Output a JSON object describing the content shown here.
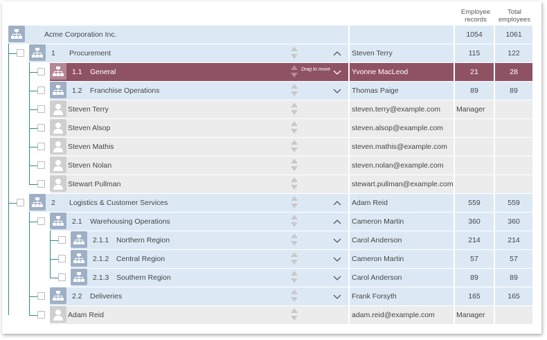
{
  "columns": {
    "records": "Employee records",
    "total": "Total employees"
  },
  "drag_hint": "Drag to move",
  "rows": [
    {
      "kind": "root",
      "num": "",
      "title": "Acme Corporation Inc.",
      "manager": "",
      "records": "1054",
      "total": "1061",
      "chevron": ""
    },
    {
      "kind": "unit",
      "num": "1",
      "title": "Procurement",
      "manager": "Steven Terry",
      "records": "115",
      "total": "122",
      "chevron": "up"
    },
    {
      "kind": "unit",
      "num": "1.1",
      "title": "General",
      "manager": "Yvonne MacLeod",
      "records": "21",
      "total": "28",
      "chevron": "down",
      "selected": true
    },
    {
      "kind": "unit",
      "num": "1.2",
      "title": "Franchise Operations",
      "manager": "Thomas Paige",
      "records": "89",
      "total": "89",
      "chevron": "down"
    },
    {
      "kind": "person",
      "num": "",
      "title": "Steven Terry",
      "manager": "steven.terry@example.com",
      "records": "Manager",
      "total": "",
      "chevron": ""
    },
    {
      "kind": "person",
      "num": "",
      "title": "Steven Alsop",
      "manager": "steven.alsop@example.com",
      "records": "",
      "total": "",
      "chevron": ""
    },
    {
      "kind": "person",
      "num": "",
      "title": "Steven Mathis",
      "manager": "steven.mathis@example.com",
      "records": "",
      "total": "",
      "chevron": ""
    },
    {
      "kind": "person",
      "num": "",
      "title": "Steven Nolan",
      "manager": "steven.nolan@example.com",
      "records": "",
      "total": "",
      "chevron": ""
    },
    {
      "kind": "person",
      "num": "",
      "title": "Stewart Pullman",
      "manager": "stewart.pullman@example.com",
      "records": "",
      "total": "",
      "chevron": ""
    },
    {
      "kind": "unit",
      "num": "2",
      "title": "Logistics & Customer Services",
      "manager": "Adam Reid",
      "records": "559",
      "total": "559",
      "chevron": "up"
    },
    {
      "kind": "unit",
      "num": "2.1",
      "title": "Warehousing Operations",
      "manager": "Cameron Martin",
      "records": "360",
      "total": "360",
      "chevron": "up"
    },
    {
      "kind": "unit",
      "num": "2.1.1",
      "title": "Northern Region",
      "manager": "Carol Anderson",
      "records": "214",
      "total": "214",
      "chevron": "down"
    },
    {
      "kind": "unit",
      "num": "2.1.2",
      "title": "Central Region",
      "manager": "Cameron Martin",
      "records": "57",
      "total": "57",
      "chevron": "down"
    },
    {
      "kind": "unit",
      "num": "2.1.3",
      "title": "Southern Region",
      "manager": "Carol Anderson",
      "records": "89",
      "total": "89",
      "chevron": "down"
    },
    {
      "kind": "unit",
      "num": "2.2",
      "title": "Deliveries",
      "manager": "Frank Forsyth",
      "records": "165",
      "total": "165",
      "chevron": "down"
    },
    {
      "kind": "person",
      "num": "",
      "title": "Adam Reid",
      "manager": "adam.reid@example.com",
      "records": "Manager",
      "total": "",
      "chevron": ""
    }
  ]
}
